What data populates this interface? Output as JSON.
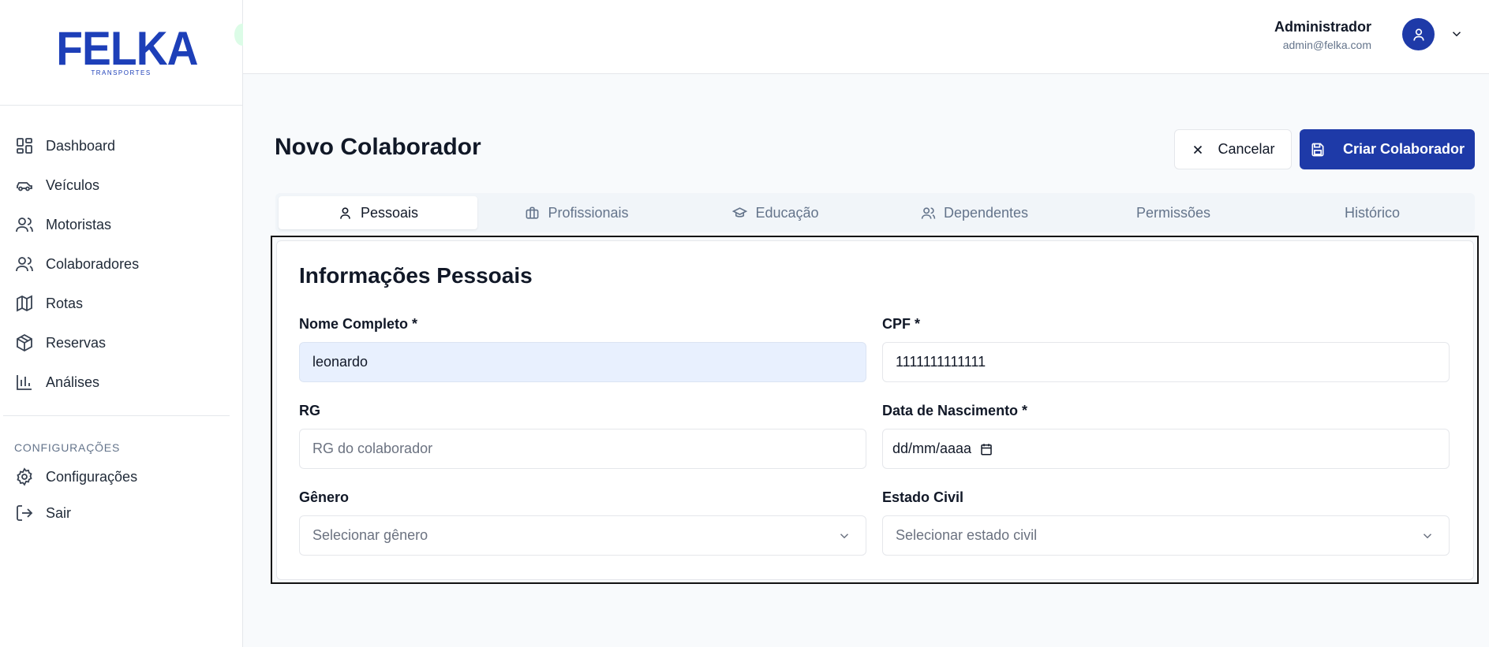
{
  "logo": {
    "title": "FELKA",
    "subtitle": "TRANSPORTES"
  },
  "sidebar": {
    "items": [
      {
        "label": "Dashboard",
        "icon": "dashboard-icon"
      },
      {
        "label": "Veículos",
        "icon": "car-icon"
      },
      {
        "label": "Motoristas",
        "icon": "users-icon"
      },
      {
        "label": "Colaboradores",
        "icon": "users-icon"
      },
      {
        "label": "Rotas",
        "icon": "map-icon"
      },
      {
        "label": "Reservas",
        "icon": "package-icon"
      },
      {
        "label": "Análises",
        "icon": "bar-chart-icon"
      }
    ],
    "section_title": "CONFIGURAÇÕES",
    "settings_items": [
      {
        "label": "Configurações",
        "icon": "gear-icon"
      },
      {
        "label": "Sair",
        "icon": "logout-icon"
      }
    ]
  },
  "header": {
    "user_name": "Administrador",
    "user_email": "admin@felka.com"
  },
  "page": {
    "title": "Novo Colaborador",
    "cancel_label": "Cancelar",
    "create_label": "Criar Colaborador"
  },
  "tabs": [
    {
      "label": "Pessoais",
      "icon": "user-icon",
      "active": true
    },
    {
      "label": "Profissionais",
      "icon": "briefcase-icon"
    },
    {
      "label": "Educação",
      "icon": "graduation-cap-icon"
    },
    {
      "label": "Dependentes",
      "icon": "users-icon"
    },
    {
      "label": "Permissões"
    },
    {
      "label": "Histórico"
    }
  ],
  "form": {
    "section_title": "Informações Pessoais",
    "nome_label": "Nome Completo *",
    "nome_value": "leonardo",
    "cpf_label": "CPF *",
    "cpf_value": "1111111111111",
    "rg_label": "RG",
    "rg_placeholder": "RG do colaborador",
    "nascimento_label": "Data de Nascimento *",
    "nascimento_placeholder": "dd/mm/aaaa",
    "genero_label": "Gênero",
    "genero_placeholder": "Selecionar gênero",
    "estado_label": "Estado Civil",
    "estado_placeholder": "Selecionar estado civil"
  },
  "colors": {
    "brand": "#1e3aa8",
    "logo": "#1d3fb8",
    "active_input_bg": "#e8f0fe"
  }
}
